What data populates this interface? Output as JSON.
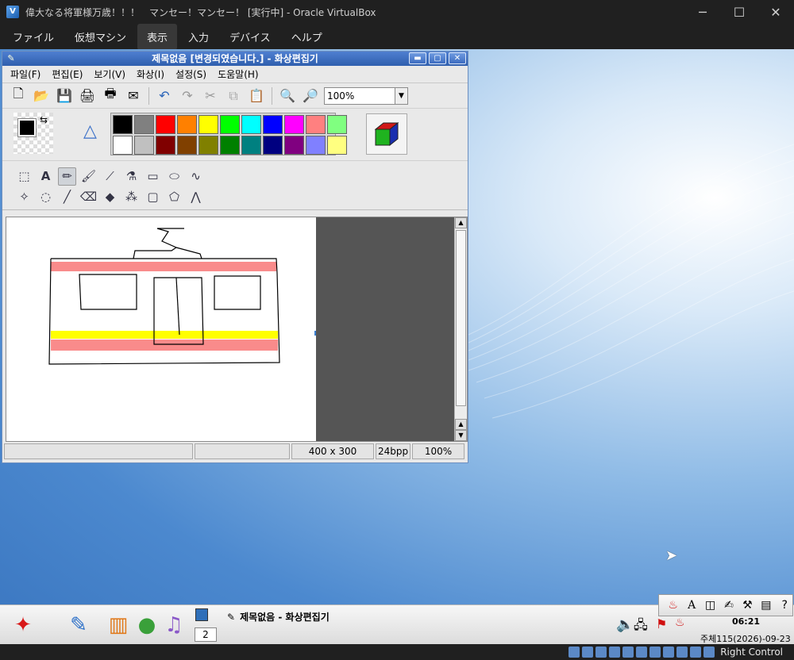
{
  "host": {
    "title": "偉大なる将軍様万歳！！！　マンセー！マンセー！ [実行中] - Oracle VirtualBox",
    "menu": [
      {
        "label": "ファイル",
        "active": false
      },
      {
        "label": "仮想マシン",
        "active": false
      },
      {
        "label": "表示",
        "active": true
      },
      {
        "label": "入力",
        "active": false
      },
      {
        "label": "デバイス",
        "active": false
      },
      {
        "label": "ヘルプ",
        "active": false
      }
    ],
    "host_key": "Right Control"
  },
  "paint": {
    "title": "제목없음 [변경되였습니다.] - 화상편집기",
    "menu": [
      "파일(F)",
      "편집(E)",
      "보기(V)",
      "화상(I)",
      "설정(S)",
      "도움말(H)"
    ],
    "zoom": "100%",
    "palette": [
      "#000000",
      "#808080",
      "#ff0000",
      "#ff8000",
      "#ffff00",
      "#00ff00",
      "#00ffff",
      "#0000ff",
      "#ff00ff",
      "#ff8080",
      "#80ff80",
      "#ffffff",
      "#c0c0c0",
      "#800000",
      "#804000",
      "#808000",
      "#008000",
      "#008080",
      "#000080",
      "#800080",
      "#8080ff",
      "#ffff80"
    ],
    "status": {
      "size": "400 x 300",
      "depth": "24bpp",
      "zoom": "100%"
    }
  },
  "taskbar": {
    "desktop_number": "2",
    "window_title": "제목없음 - 화상편집기",
    "clock": "06:21",
    "date": "주체115(2026)-09-23"
  }
}
